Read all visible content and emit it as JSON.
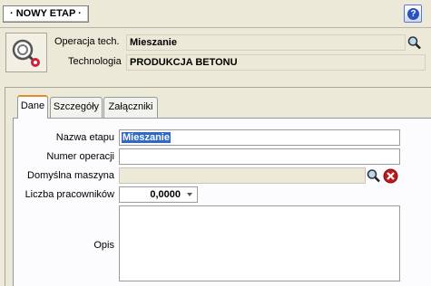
{
  "window": {
    "title": "· NOWY ETAP ·",
    "help_label": "?"
  },
  "header": {
    "operation_label": "Operacja tech.",
    "operation_value": "Mieszanie",
    "technology_label": "Technologia",
    "technology_value": "PRODUKCJA BETONU"
  },
  "tabs": [
    {
      "label": "Dane"
    },
    {
      "label": "Szczegóły"
    },
    {
      "label": "Załączniki"
    }
  ],
  "form": {
    "stage_name_label": "Nazwa etapu",
    "stage_name_value": "Mieszanie",
    "operation_number_label": "Numer operacji",
    "operation_number_value": "",
    "default_machine_label": "Domyślna maszyna",
    "default_machine_value": "",
    "workers_label": "Liczba pracowników",
    "workers_value": "0,0000",
    "description_label": "Opis",
    "description_value": ""
  },
  "colors": {
    "accent": "#e68b2c",
    "selection": "#316ac5",
    "help_icon": "#2a52be",
    "clear_icon": "#c0191c"
  }
}
